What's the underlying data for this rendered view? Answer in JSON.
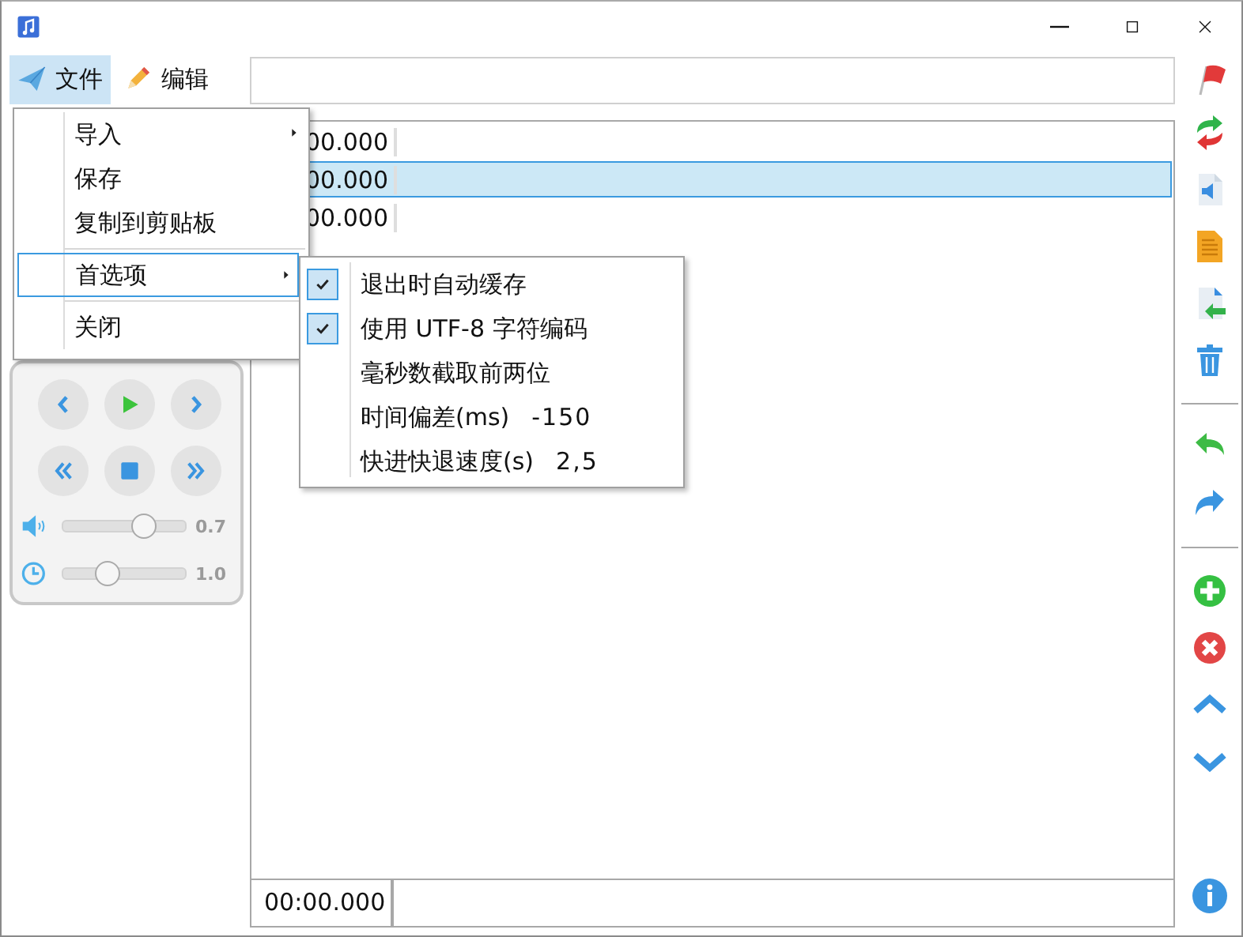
{
  "menu_bar": {
    "items": [
      {
        "label": "文件",
        "selected": true
      },
      {
        "label": "编辑",
        "selected": false
      }
    ]
  },
  "file_menu": {
    "items": [
      {
        "kind": "submenu",
        "label": "导入",
        "selected": false
      },
      {
        "kind": "item",
        "label": "保存",
        "selected": false
      },
      {
        "kind": "item",
        "label": "复制到剪贴板",
        "selected": false
      },
      {
        "kind": "separator"
      },
      {
        "kind": "submenu",
        "label": "首选项",
        "selected": true
      },
      {
        "kind": "separator"
      },
      {
        "kind": "item",
        "label": "关闭",
        "selected": false
      }
    ]
  },
  "preferences_menu": {
    "items": [
      {
        "kind": "check",
        "label": "退出时自动缓存",
        "checked": true
      },
      {
        "kind": "check",
        "label": "使用 UTF-8 字符编码",
        "checked": true
      },
      {
        "kind": "check",
        "label": "毫秒数截取前两位",
        "checked": false
      },
      {
        "kind": "value",
        "label": "时间偏差(ms)",
        "value": "-150"
      },
      {
        "kind": "value",
        "label": "快进快退速度(s)",
        "value": "2,5"
      }
    ]
  },
  "player": {
    "sliders": [
      {
        "kind": "volume",
        "level": 0.7,
        "reading": "0.7"
      },
      {
        "kind": "speed",
        "level": 0.34,
        "reading": "1.0"
      }
    ]
  },
  "subtitle_list": {
    "rows": [
      {
        "time": "00.000",
        "selected": false
      },
      {
        "time": "00.000",
        "selected": true
      },
      {
        "time": "00.000",
        "selected": false
      }
    ]
  },
  "editor": {
    "time": "00:00.000"
  }
}
